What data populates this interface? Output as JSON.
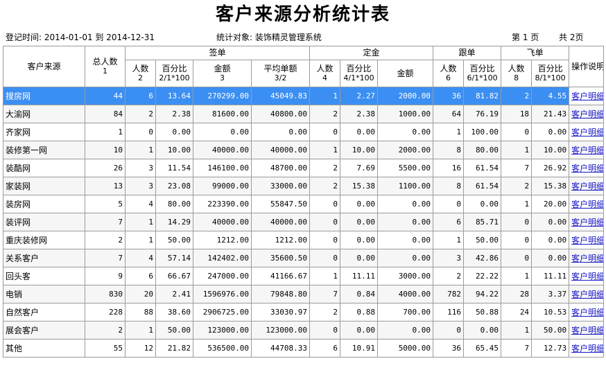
{
  "report": {
    "title": "客户来源分析统计表",
    "period": "登记时间: 2014-01-01 到 2014-12-31",
    "target": "统计对象: 装饰精灵管理系统",
    "page_current": "第 1 页",
    "page_total": "共 2页"
  },
  "headers": {
    "source": "客户来源",
    "total": "总人数",
    "total_sub": "1",
    "group_signed": "签单",
    "group_deposit": "定金",
    "group_follow": "跟单",
    "group_lost": "飞单",
    "action": "操作说明",
    "signed_count": "人数",
    "signed_count_sub": "2",
    "signed_pct": "百分比",
    "signed_pct_sub": "2/1*100",
    "signed_amount": "金额",
    "signed_amount_sub": "3",
    "signed_avg": "平均单额",
    "signed_avg_sub": "3/2",
    "deposit_count": "人数",
    "deposit_count_sub": "4",
    "deposit_pct": "百分比",
    "deposit_pct_sub": "4/1*100",
    "deposit_amount": "金额",
    "follow_count": "人数",
    "follow_count_sub": "6",
    "follow_pct": "百分比",
    "follow_pct_sub": "6/1*100",
    "lost_count": "人数",
    "lost_count_sub": "8",
    "lost_pct": "百分比",
    "lost_pct_sub": "8/1*100"
  },
  "selected_row": 0,
  "rows": [
    {
      "source": "搜房网",
      "total": "44",
      "s_cnt": "6",
      "s_pct": "13.64",
      "s_amt": "270299.00",
      "s_avg": "45049.83",
      "d_cnt": "1",
      "d_pct": "2.27",
      "d_amt": "2000.00",
      "f_cnt": "36",
      "f_pct": "81.82",
      "l_cnt": "2",
      "l_pct": "4.55",
      "action": "客户明细"
    },
    {
      "source": "大渝网",
      "total": "84",
      "s_cnt": "2",
      "s_pct": "2.38",
      "s_amt": "81600.00",
      "s_avg": "40800.00",
      "d_cnt": "2",
      "d_pct": "2.38",
      "d_amt": "1000.00",
      "f_cnt": "64",
      "f_pct": "76.19",
      "l_cnt": "18",
      "l_pct": "21.43",
      "action": "客户明细"
    },
    {
      "source": "齐家网",
      "total": "1",
      "s_cnt": "0",
      "s_pct": "0.00",
      "s_amt": "0.00",
      "s_avg": "0.00",
      "d_cnt": "0",
      "d_pct": "0.00",
      "d_amt": "0.00",
      "f_cnt": "1",
      "f_pct": "100.00",
      "l_cnt": "0",
      "l_pct": "0.00",
      "action": "客户明细"
    },
    {
      "source": "装修第一网",
      "total": "10",
      "s_cnt": "1",
      "s_pct": "10.00",
      "s_amt": "40000.00",
      "s_avg": "40000.00",
      "d_cnt": "1",
      "d_pct": "10.00",
      "d_amt": "2000.00",
      "f_cnt": "8",
      "f_pct": "80.00",
      "l_cnt": "1",
      "l_pct": "10.00",
      "action": "客户明细"
    },
    {
      "source": "装酷网",
      "total": "26",
      "s_cnt": "3",
      "s_pct": "11.54",
      "s_amt": "146100.00",
      "s_avg": "48700.00",
      "d_cnt": "2",
      "d_pct": "7.69",
      "d_amt": "5500.00",
      "f_cnt": "16",
      "f_pct": "61.54",
      "l_cnt": "7",
      "l_pct": "26.92",
      "action": "客户明细"
    },
    {
      "source": "家装网",
      "total": "13",
      "s_cnt": "3",
      "s_pct": "23.08",
      "s_amt": "99000.00",
      "s_avg": "33000.00",
      "d_cnt": "2",
      "d_pct": "15.38",
      "d_amt": "1100.00",
      "f_cnt": "8",
      "f_pct": "61.54",
      "l_cnt": "2",
      "l_pct": "15.38",
      "action": "客户明细"
    },
    {
      "source": "装房网",
      "total": "5",
      "s_cnt": "4",
      "s_pct": "80.00",
      "s_amt": "223390.00",
      "s_avg": "55847.50",
      "d_cnt": "0",
      "d_pct": "0.00",
      "d_amt": "0.00",
      "f_cnt": "0",
      "f_pct": "0.00",
      "l_cnt": "1",
      "l_pct": "20.00",
      "action": "客户明细"
    },
    {
      "source": "装评网",
      "total": "7",
      "s_cnt": "1",
      "s_pct": "14.29",
      "s_amt": "40000.00",
      "s_avg": "40000.00",
      "d_cnt": "0",
      "d_pct": "0.00",
      "d_amt": "0.00",
      "f_cnt": "6",
      "f_pct": "85.71",
      "l_cnt": "0",
      "l_pct": "0.00",
      "action": "客户明细"
    },
    {
      "source": "重庆装修网",
      "total": "2",
      "s_cnt": "1",
      "s_pct": "50.00",
      "s_amt": "1212.00",
      "s_avg": "1212.00",
      "d_cnt": "0",
      "d_pct": "0.00",
      "d_amt": "0.00",
      "f_cnt": "1",
      "f_pct": "50.00",
      "l_cnt": "0",
      "l_pct": "0.00",
      "action": "客户明细"
    },
    {
      "source": "关系客户",
      "total": "7",
      "s_cnt": "4",
      "s_pct": "57.14",
      "s_amt": "142402.00",
      "s_avg": "35600.50",
      "d_cnt": "0",
      "d_pct": "0.00",
      "d_amt": "0.00",
      "f_cnt": "3",
      "f_pct": "42.86",
      "l_cnt": "0",
      "l_pct": "0.00",
      "action": "客户明细"
    },
    {
      "source": "回头客",
      "total": "9",
      "s_cnt": "6",
      "s_pct": "66.67",
      "s_amt": "247000.00",
      "s_avg": "41166.67",
      "d_cnt": "1",
      "d_pct": "11.11",
      "d_amt": "3000.00",
      "f_cnt": "2",
      "f_pct": "22.22",
      "l_cnt": "1",
      "l_pct": "11.11",
      "action": "客户明细"
    },
    {
      "source": "电销",
      "total": "830",
      "s_cnt": "20",
      "s_pct": "2.41",
      "s_amt": "1596976.00",
      "s_avg": "79848.80",
      "d_cnt": "7",
      "d_pct": "0.84",
      "d_amt": "4000.00",
      "f_cnt": "782",
      "f_pct": "94.22",
      "l_cnt": "28",
      "l_pct": "3.37",
      "action": "客户明细"
    },
    {
      "source": "自然客户",
      "total": "228",
      "s_cnt": "88",
      "s_pct": "38.60",
      "s_amt": "2906725.00",
      "s_avg": "33030.97",
      "d_cnt": "2",
      "d_pct": "0.88",
      "d_amt": "700.00",
      "f_cnt": "116",
      "f_pct": "50.88",
      "l_cnt": "24",
      "l_pct": "10.53",
      "action": "客户明细"
    },
    {
      "source": "展会客户",
      "total": "2",
      "s_cnt": "1",
      "s_pct": "50.00",
      "s_amt": "123000.00",
      "s_avg": "123000.00",
      "d_cnt": "0",
      "d_pct": "0.00",
      "d_amt": "0.00",
      "f_cnt": "0",
      "f_pct": "0.00",
      "l_cnt": "1",
      "l_pct": "50.00",
      "action": "客户明细"
    },
    {
      "source": "其他",
      "total": "55",
      "s_cnt": "12",
      "s_pct": "21.82",
      "s_amt": "536500.00",
      "s_avg": "44708.33",
      "d_cnt": "6",
      "d_pct": "10.91",
      "d_amt": "5000.00",
      "f_cnt": "36",
      "f_pct": "65.45",
      "l_cnt": "7",
      "l_pct": "12.73",
      "action": "客户明细"
    }
  ]
}
